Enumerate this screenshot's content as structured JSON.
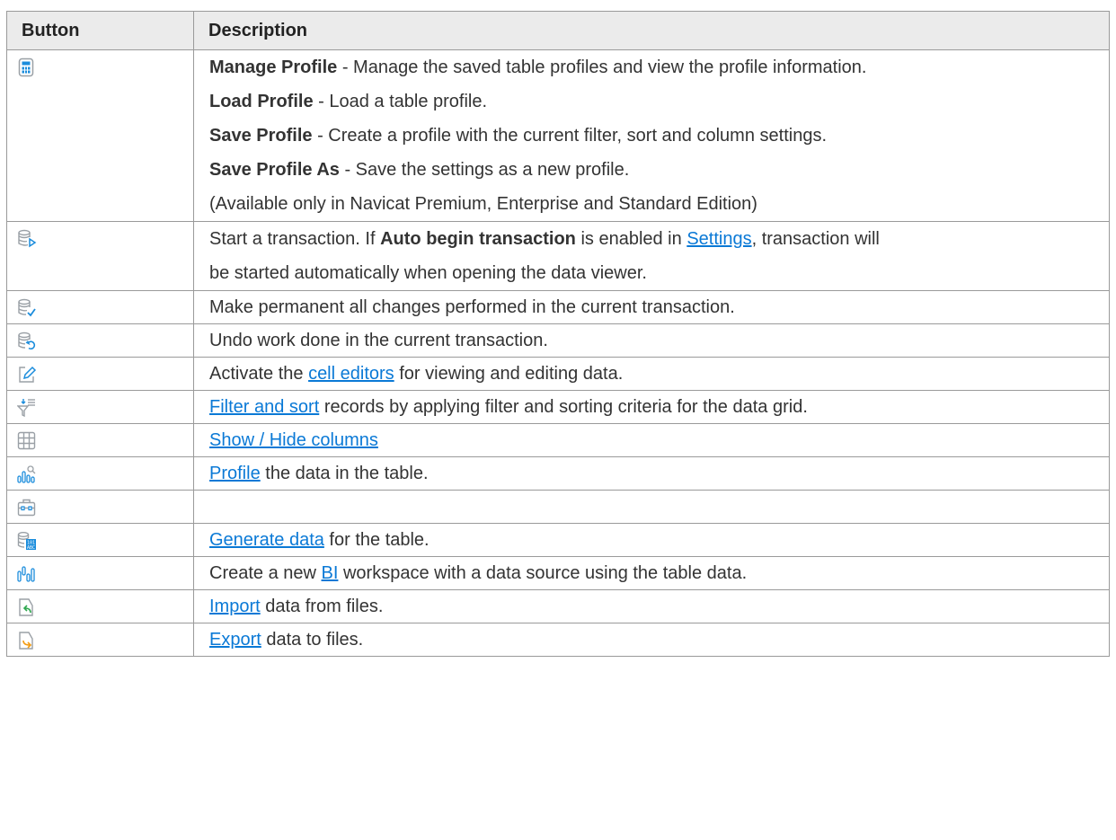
{
  "headers": {
    "button": "Button",
    "description": "Description"
  },
  "rows": [
    {
      "icon": "manage-profile-icon",
      "lines": [
        {
          "bold": "Manage Profile",
          "text": " - Manage the saved table profiles and view the profile information."
        },
        {
          "bold": "Load Profile",
          "text": " - Load a table profile."
        },
        {
          "bold": "Save Profile",
          "text": " - Create a profile with the current filter, sort and column settings."
        },
        {
          "bold": "Save Profile As",
          "text": " - Save the settings as a new profile."
        },
        {
          "text": "(Available only in Navicat Premium, Enterprise and Standard Edition)"
        }
      ]
    },
    {
      "icon": "start-transaction-icon",
      "line1_pre": "Start a transaction. If ",
      "line1_bold": "Auto begin transaction",
      "line1_mid": " is enabled in ",
      "line1_link": "Settings",
      "line1_post": ", transaction will",
      "line2": "be started automatically when opening the data viewer."
    },
    {
      "icon": "commit-icon",
      "text": "Make permanent all changes performed in the current transaction."
    },
    {
      "icon": "rollback-icon",
      "text": "Undo work done in the current transaction."
    },
    {
      "icon": "edit-icon",
      "pre": "Activate the ",
      "link": "cell editors",
      "post": " for viewing and editing data."
    },
    {
      "icon": "filter-sort-icon",
      "link": "Filter and sort",
      "post": " records by applying filter and sorting criteria for the data grid."
    },
    {
      "icon": "columns-icon",
      "link": "Show / Hide columns",
      "post": ""
    },
    {
      "icon": "profile-data-icon",
      "link": "Profile",
      "post": " the data in the table."
    },
    {
      "icon": "toolbox-icon",
      "text": ""
    },
    {
      "icon": "generate-data-icon",
      "link": "Generate data",
      "post": " for the table."
    },
    {
      "icon": "bi-icon",
      "pre": "Create a new ",
      "link": "BI",
      "post": " workspace with a data source using the table data."
    },
    {
      "icon": "import-icon",
      "link": "Import",
      "post": " data from files."
    },
    {
      "icon": "export-icon",
      "link": "Export",
      "post": " data to files."
    }
  ],
  "colors": {
    "link": "#0a79d6",
    "header_bg": "#ebebeb",
    "border": "#9a9a9a",
    "icon_gray": "#9aa0a6",
    "icon_blue": "#1a8cdc",
    "icon_green": "#2fa84f",
    "icon_orange": "#f39c12"
  }
}
